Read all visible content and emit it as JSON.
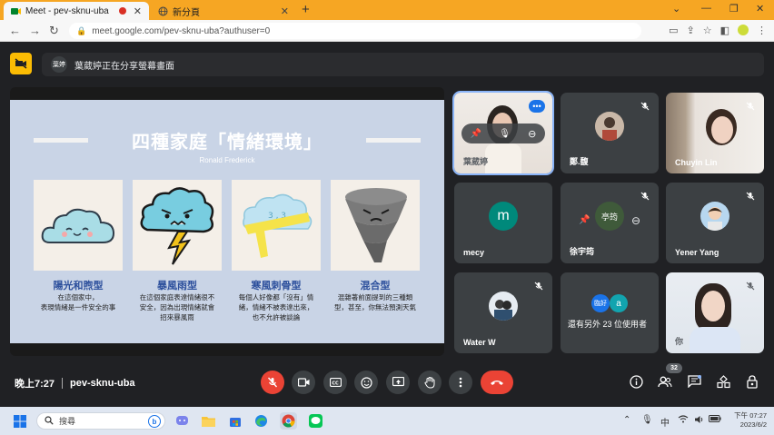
{
  "browser": {
    "tabs": [
      {
        "label": "Meet - pev-sknu-uba",
        "active": true,
        "recording": true
      },
      {
        "label": "新分頁",
        "active": false
      }
    ],
    "new_tab_icon": "plus-icon",
    "url": "meet.google.com/pev-sknu-uba?authuser=0",
    "window_controls": [
      "chevron-down-icon",
      "minimize-icon",
      "restore-icon",
      "close-icon"
    ]
  },
  "share_banner": {
    "avatar_text": "葉婷",
    "text": "葉葳婷正在分享螢幕畫面"
  },
  "slide": {
    "title": "四種家庭「情緒環境」",
    "subtitle": "Ronald Frederick",
    "cards": [
      {
        "title": "陽光和煦型",
        "desc1": "在這個家中，",
        "desc2": "表現情緒是一件安全的事",
        "desc3": ""
      },
      {
        "title": "暴風雨型",
        "desc1": "在這個家庭表達情緒很不",
        "desc2": "安全，因為出現情緒就會",
        "desc3": "招來暴風雨"
      },
      {
        "title": "寒風刺骨型",
        "desc1": "每個人好像都「沒有」情",
        "desc2": "緒，情緒不被表達出來，",
        "desc3": "也不允許被談論"
      },
      {
        "title": "混合型",
        "desc1": "混雜著前面提到的三種類",
        "desc2": "型，甚至，你無法預測天氣",
        "desc3": ""
      }
    ]
  },
  "participants": [
    {
      "name": "葉葳婷",
      "type": "photo",
      "speaking": true
    },
    {
      "name": "鄭.馥",
      "type": "avatar",
      "muted": true
    },
    {
      "name": "Chuyin Lin",
      "type": "photo",
      "muted": true
    },
    {
      "name": "mecy",
      "type": "letter",
      "letter": "m",
      "color": "#00897b"
    },
    {
      "name": "徐宇筠",
      "type": "avatar",
      "muted": true,
      "avatar_text": "亭筠"
    },
    {
      "name": "Yener Yang",
      "type": "avatar",
      "muted": true
    },
    {
      "name": "Water W",
      "type": "avatar",
      "muted": true
    },
    {
      "name": "還有另外 23 位使用者",
      "type": "group",
      "avatar1": "臨好",
      "avatar2": "a"
    },
    {
      "name": "你",
      "type": "photo",
      "muted": true
    }
  ],
  "meeting": {
    "time": "晚上7:27",
    "code": "pev-sknu-uba",
    "participant_count": "32"
  },
  "controls": [
    "mic-off-icon",
    "camera-icon",
    "captions-icon",
    "emoji-icon",
    "present-icon",
    "raise-hand-icon",
    "more-icon",
    "hang-up-icon"
  ],
  "right_controls": [
    "info-icon",
    "people-icon",
    "chat-icon",
    "activities-icon",
    "host-controls-icon"
  ],
  "taskbar": {
    "search_placeholder": "搜尋",
    "ime": "中",
    "clock_time": "下午 07:27",
    "clock_date": "2023/6/2"
  },
  "colors": {
    "accent": "#f6a623",
    "meet_bg": "#202124",
    "tile_bg": "#3c4043",
    "hangup": "#ea4335",
    "slide_bg": "#c9d4e6",
    "slide_title": "#2c4f9c"
  }
}
